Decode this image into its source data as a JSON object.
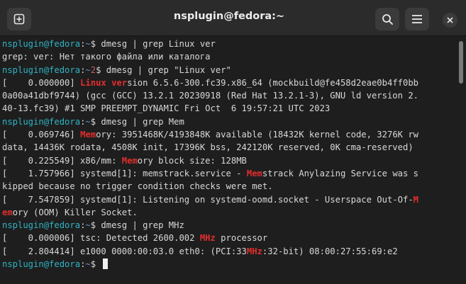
{
  "window": {
    "title": "nsplugin@fedora:~"
  },
  "icons": {
    "new_tab": "new-tab-plus-icon",
    "search": "magnifier-search-icon",
    "menu": "hamburger-menu-icon",
    "close": "close-x-icon"
  },
  "colors": {
    "prompt_user": "#2fb4c4",
    "prompt_path": "#6b8fc7",
    "grep_match": "#e22e2e",
    "exit_code": "#c75d5d",
    "background": "#1e1e1e",
    "titlebar": "#2b2b2b"
  },
  "terminal": {
    "lines": [
      {
        "segments": [
          {
            "text": "nsplugin@fedora",
            "style": "user"
          },
          {
            "text": ":",
            "style": "pcol"
          },
          {
            "text": "~",
            "style": "path"
          },
          {
            "text": "$ dmesg | grep Linux ver",
            "style": "plain"
          }
        ]
      },
      {
        "segments": [
          {
            "text": "grep: ver: Нет такого файла или каталога",
            "style": "plain"
          }
        ]
      },
      {
        "segments": [
          {
            "text": "nsplugin@fedora",
            "style": "user"
          },
          {
            "text": ":",
            "style": "pcol"
          },
          {
            "text": "~",
            "style": "path"
          },
          {
            "text": "2",
            "style": "err"
          },
          {
            "text": "$ dmesg | grep \"Linux ver\"",
            "style": "plain"
          }
        ]
      },
      {
        "segments": [
          {
            "text": "[    0.000000] ",
            "style": "plain"
          },
          {
            "text": "Linux ver",
            "style": "hl"
          },
          {
            "text": "sion 6.5.6-300.fc39.x86_64 (mockbuild@fe458d2eae0b4ff0bb",
            "style": "plain"
          }
        ]
      },
      {
        "segments": [
          {
            "text": "0a00a41dbf9744) (gcc (GCC) 13.2.1 20230918 (Red Hat 13.2.1-3), GNU ld version 2.",
            "style": "plain"
          }
        ]
      },
      {
        "segments": [
          {
            "text": "40-13.fc39) #1 SMP PREEMPT_DYNAMIC Fri Oct  6 19:57:21 UTC 2023",
            "style": "plain"
          }
        ]
      },
      {
        "segments": [
          {
            "text": "nsplugin@fedora",
            "style": "user"
          },
          {
            "text": ":",
            "style": "pcol"
          },
          {
            "text": "~",
            "style": "path"
          },
          {
            "text": "$ dmesg | grep Mem",
            "style": "plain"
          }
        ]
      },
      {
        "segments": [
          {
            "text": "[    0.069746] ",
            "style": "plain"
          },
          {
            "text": "Mem",
            "style": "hl"
          },
          {
            "text": "ory: 3951468K/4193848K available (18432K kernel code, 3276K rw",
            "style": "plain"
          }
        ]
      },
      {
        "segments": [
          {
            "text": "data, 14436K rodata, 4508K init, 17396K bss, 242120K reserved, 0K cma-reserved)",
            "style": "plain"
          }
        ]
      },
      {
        "segments": [
          {
            "text": "[    0.225549] x86/mm: ",
            "style": "plain"
          },
          {
            "text": "Mem",
            "style": "hl"
          },
          {
            "text": "ory block size: 128MB",
            "style": "plain"
          }
        ]
      },
      {
        "segments": [
          {
            "text": "[    1.757966] systemd[1]: memstrack.service - ",
            "style": "plain"
          },
          {
            "text": "Mem",
            "style": "hl"
          },
          {
            "text": "strack Anylazing Service was s",
            "style": "plain"
          }
        ]
      },
      {
        "segments": [
          {
            "text": "kipped because no trigger condition checks were met.",
            "style": "plain"
          }
        ]
      },
      {
        "segments": [
          {
            "text": "[    7.547859] systemd[1]: Listening on systemd-oomd.socket - Userspace Out-Of-",
            "style": "plain"
          },
          {
            "text": "M",
            "style": "hl"
          }
        ]
      },
      {
        "segments": [
          {
            "text": "em",
            "style": "hl"
          },
          {
            "text": "ory (OOM) Killer Socket.",
            "style": "plain"
          }
        ]
      },
      {
        "segments": [
          {
            "text": "nsplugin@fedora",
            "style": "user"
          },
          {
            "text": ":",
            "style": "pcol"
          },
          {
            "text": "~",
            "style": "path"
          },
          {
            "text": "$ dmesg | grep MHz",
            "style": "plain"
          }
        ]
      },
      {
        "segments": [
          {
            "text": "[    0.000006] tsc: Detected 2600.002 ",
            "style": "plain"
          },
          {
            "text": "MHz",
            "style": "hl"
          },
          {
            "text": " processor",
            "style": "plain"
          }
        ]
      },
      {
        "segments": [
          {
            "text": "[    2.804414] e1000 0000:00:03.0 eth0: (PCI:33",
            "style": "plain"
          },
          {
            "text": "MHz",
            "style": "hl"
          },
          {
            "text": ":32-bit) 08:00:27:55:69:e2",
            "style": "plain"
          }
        ]
      },
      {
        "segments": [
          {
            "text": "nsplugin@fedora",
            "style": "user"
          },
          {
            "text": ":",
            "style": "pcol"
          },
          {
            "text": "~",
            "style": "path"
          },
          {
            "text": "$ ",
            "style": "plain"
          }
        ],
        "cursor": true
      }
    ]
  }
}
